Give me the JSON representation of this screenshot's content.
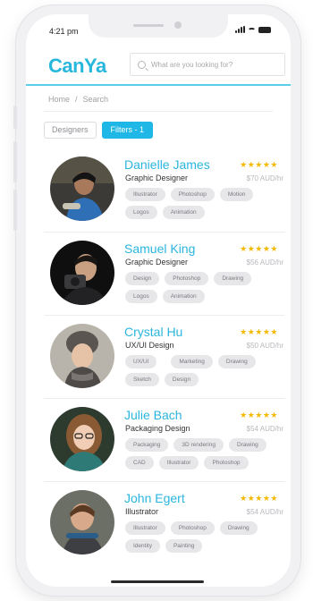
{
  "status_bar": {
    "time": "4:21 pm"
  },
  "header": {
    "logo": "CanYa",
    "search": {
      "placeholder": "What are you looking for?"
    }
  },
  "breadcrumb": {
    "home": "Home",
    "separator": "/",
    "current": "Search"
  },
  "filters": {
    "designers_label": "Designers",
    "filters_label": "Filters - 1"
  },
  "colors": {
    "accent": "#1fb8e6",
    "name_blue": "#2bb5de",
    "star_gold": "#f5b800"
  },
  "results": [
    {
      "name": "Danielle James",
      "role": "Graphic Designer",
      "rate": "$70 AUD/hr",
      "stars": "★★★★★",
      "tags": [
        "Illustrator",
        "Photoshop",
        "Motion",
        "Logos",
        "Animation"
      ]
    },
    {
      "name": "Samuel King",
      "role": "Graphic Designer",
      "rate": "$56 AUD/hr",
      "stars": "★★★★★",
      "tags": [
        "Design",
        "Photoshop",
        "Drawing",
        "Logos",
        "Animation"
      ]
    },
    {
      "name": "Crystal Hu",
      "role": "UX/UI Design",
      "rate": "$50 AUD/hr",
      "stars": "★★★★★",
      "tags": [
        "UX/UI",
        "Marketing",
        "Drawing",
        "Sketch",
        "Design"
      ]
    },
    {
      "name": "Julie Bach",
      "role": "Packaging Design",
      "rate": "$54 AUD/hr",
      "stars": "★★★★★",
      "tags": [
        "Packaging",
        "3D rendering",
        "Drawing",
        "CAD",
        "Illustrator",
        "Photoshop"
      ]
    },
    {
      "name": "John Egert",
      "role": "Illustrator",
      "rate": "$54 AUD/hr",
      "stars": "★★★★★",
      "tags": [
        "Illustrator",
        "Photoshop",
        "Drawing",
        "Identity",
        "Painting"
      ]
    }
  ]
}
